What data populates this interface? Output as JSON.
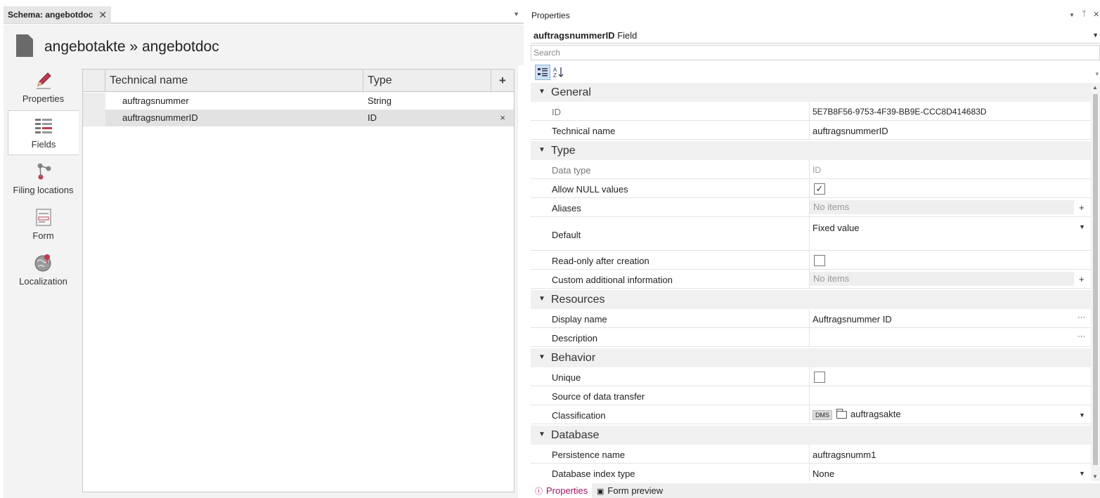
{
  "document_tab": {
    "title": "Schema: angebotdoc"
  },
  "schema": {
    "title": "angebotakte » angebotdoc"
  },
  "nav": [
    {
      "label": "Properties",
      "icon": "pencil-icon"
    },
    {
      "label": "Fields",
      "icon": "fields-icon"
    },
    {
      "label": "Filing locations",
      "icon": "filing-locations-icon"
    },
    {
      "label": "Form",
      "icon": "form-icon"
    },
    {
      "label": "Localization",
      "icon": "globe-icon"
    }
  ],
  "fields_grid": {
    "columns": [
      "Technical name",
      "Type"
    ],
    "add_label": "+",
    "rows": [
      {
        "name": "auftragsnummer",
        "type": "String"
      },
      {
        "name": "auftragsnummerID",
        "type": "ID",
        "delete": "×"
      }
    ]
  },
  "properties": {
    "pane_title": "Properties",
    "object_name": "auftragsnummerID",
    "object_kind": " Field",
    "search_placeholder": "Search",
    "categories": {
      "general": "General",
      "type": "Type",
      "resources": "Resources",
      "behavior": "Behavior",
      "database": "Database"
    },
    "rows": {
      "id": {
        "name": "ID",
        "value": "5E7B8F56-9753-4F39-BB9E-CCC8D414683D"
      },
      "technical_name": {
        "name": "Technical name",
        "value": "auftragsnummerID"
      },
      "data_type": {
        "name": "Data type",
        "value": "ID"
      },
      "allow_null": {
        "name": "Allow NULL values",
        "checked": true
      },
      "aliases": {
        "name": "Aliases",
        "value": "No items"
      },
      "default": {
        "name": "Default",
        "value": "Fixed value"
      },
      "read_only": {
        "name": "Read-only after creation",
        "checked": false
      },
      "custom_info": {
        "name": "Custom additional information",
        "value": "No items"
      },
      "display_name": {
        "name": "Display name",
        "value": "Auftragsnummer ID"
      },
      "description": {
        "name": "Description",
        "value": ""
      },
      "unique": {
        "name": "Unique",
        "checked": false
      },
      "source_transfer": {
        "name": "Source of data transfer",
        "value": ""
      },
      "classification": {
        "name": "Classification",
        "badge": "DMS",
        "value": "auftragsakte"
      },
      "persistence_name": {
        "name": "Persistence name",
        "value": "auftragsnumm1"
      },
      "db_index_type": {
        "name": "Database index type",
        "value": "None"
      }
    }
  },
  "bottom_tabs": {
    "properties": "Properties",
    "form_preview": "Form preview"
  },
  "colors": {
    "accent": "#a3155e",
    "selection": "#e2e2e2",
    "toolbar_active": "#cfe3f5"
  }
}
